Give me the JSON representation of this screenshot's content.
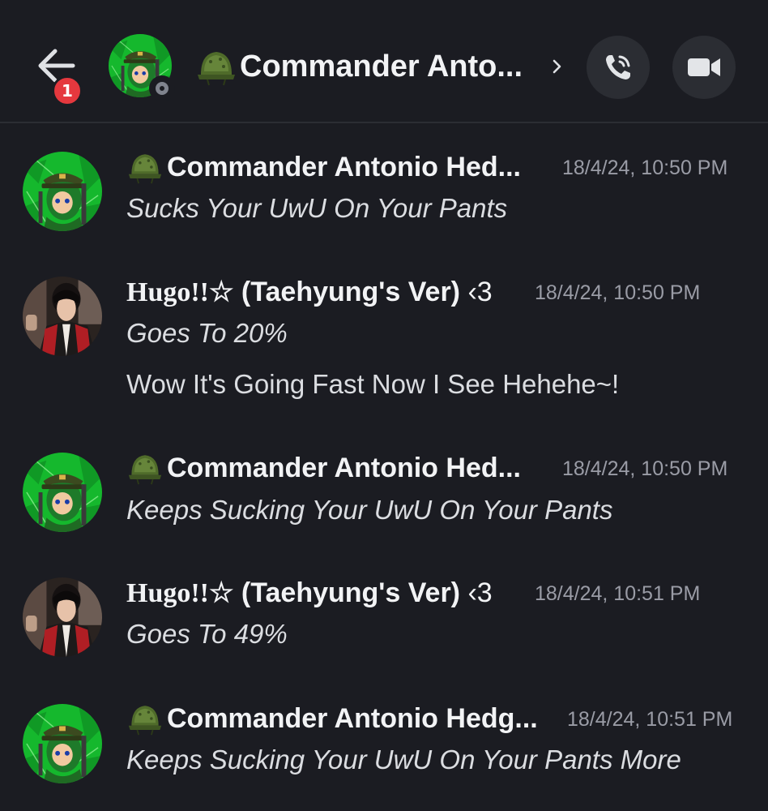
{
  "header": {
    "notification_count": "1",
    "title": "Commander Anto...",
    "chevron": "chevron-right-icon",
    "call_icon": "phone-call-icon",
    "video_icon": "video-camera-icon",
    "status": "offline"
  },
  "messages": [
    {
      "author": "Commander Antonio Hed...",
      "author_icon": "army-helmet-icon",
      "timestamp": "18/4/24, 10:50 PM",
      "lines": [
        "Sucks Your UwU On Your Pants"
      ]
    },
    {
      "author_main": "Hugo!!☆",
      "author_rest": " (Taehyung's Ver)",
      "author_tail": " ‹3",
      "timestamp": "18/4/24, 10:50 PM",
      "lines": [
        "Goes To 20%",
        "Wow It's Going Fast Now I See Hehehe~!"
      ]
    },
    {
      "author": "Commander Antonio Hed...",
      "author_icon": "army-helmet-icon",
      "timestamp": "18/4/24, 10:50 PM",
      "lines": [
        "Keeps Sucking Your UwU On Your Pants"
      ]
    },
    {
      "author_main": "Hugo!!☆",
      "author_rest": " (Taehyung's Ver)",
      "author_tail": " ‹3",
      "timestamp": "18/4/24, 10:51 PM",
      "lines": [
        "Goes To 49%"
      ]
    },
    {
      "author": "Commander Antonio Hedg...",
      "author_icon": "army-helmet-icon",
      "timestamp": "18/4/24, 10:51 PM",
      "lines": [
        "Keeps Sucking Your UwU On Your Pants More"
      ]
    }
  ],
  "colors": {
    "background": "#1b1c22",
    "badge": "#e5383e",
    "button_bg": "#2b2d33",
    "timestamp": "#9a9ca6"
  }
}
